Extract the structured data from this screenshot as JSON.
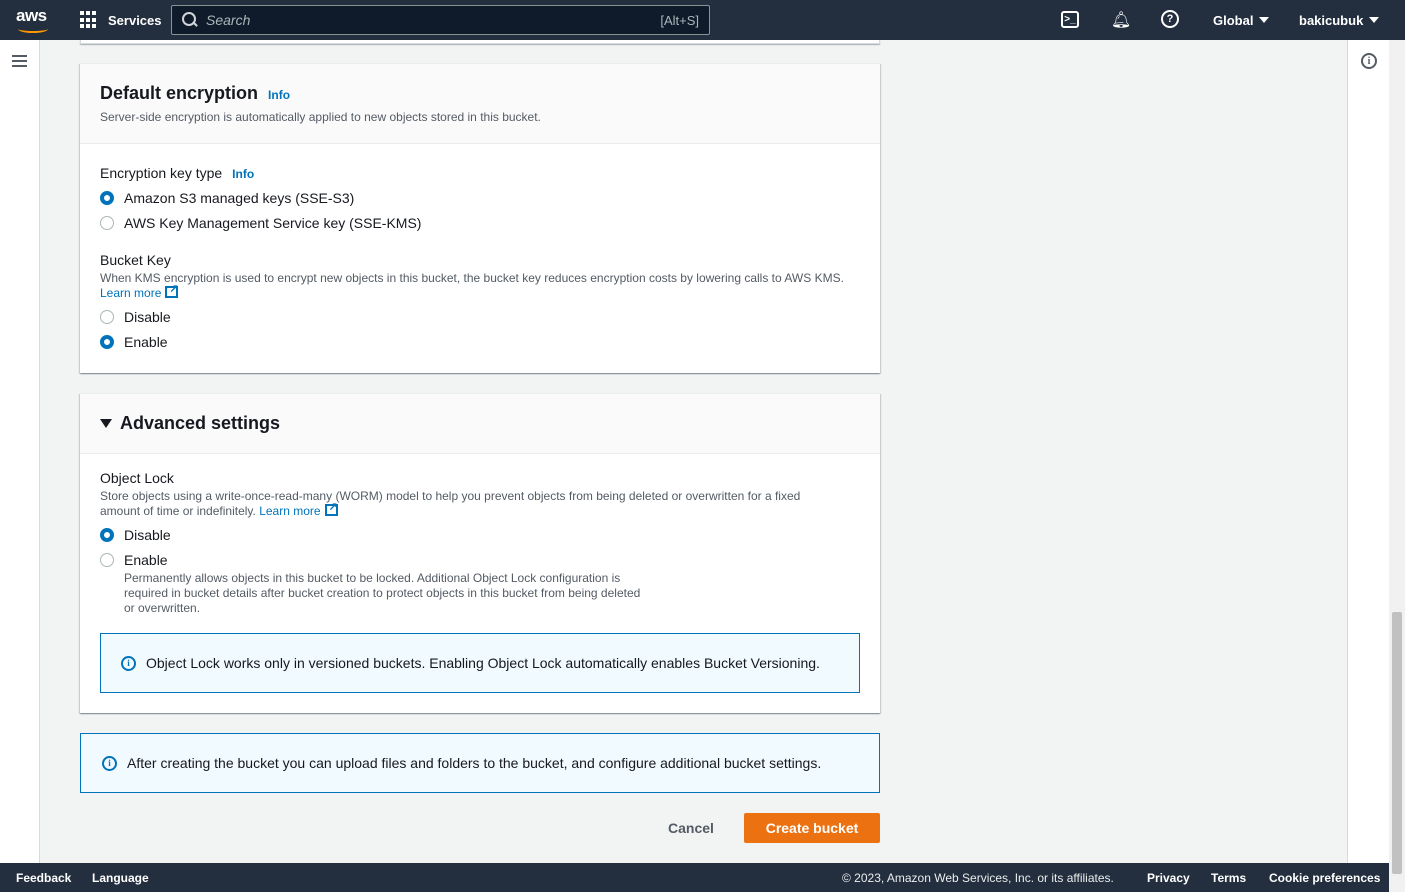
{
  "topnav": {
    "logo": "aws",
    "services_label": "Services",
    "search_placeholder": "Search",
    "search_shortcut": "[Alt+S]",
    "region_label": "Global",
    "user_label": "bakicubuk"
  },
  "default_encryption": {
    "title": "Default encryption",
    "info": "Info",
    "description": "Server-side encryption is automatically applied to new objects stored in this bucket.",
    "key_type_label": "Encryption key type",
    "key_type_info": "Info",
    "key_options": [
      "Amazon S3 managed keys (SSE-S3)",
      "AWS Key Management Service key (SSE-KMS)"
    ],
    "key_selected": 0,
    "bucket_key_label": "Bucket Key",
    "bucket_key_description": "When KMS encryption is used to encrypt new objects in this bucket, the bucket key reduces encryption costs by lowering calls to AWS KMS.",
    "bucket_key_learn_more": "Learn more",
    "bucket_key_options": [
      "Disable",
      "Enable"
    ],
    "bucket_key_selected": 1
  },
  "advanced_settings": {
    "title": "Advanced settings",
    "object_lock_label": "Object Lock",
    "object_lock_description": "Store objects using a write-once-read-many (WORM) model to help you prevent objects from being deleted or overwritten for a fixed amount of time or indefinitely.",
    "object_lock_learn_more": "Learn more",
    "object_lock_options": [
      "Disable",
      "Enable"
    ],
    "object_lock_selected": 0,
    "enable_description_1": "Permanently allows objects in this bucket to be locked. Additional Object Lock configuration is",
    "enable_description_2": "required in bucket details after bucket creation to protect objects in this bucket from being deleted",
    "enable_description_3": "or overwritten.",
    "alert_text": "Object Lock works only in versioned buckets. Enabling Object Lock automatically enables Bucket Versioning."
  },
  "bottom_alert": "After creating the bucket you can upload files and folders to the bucket, and configure additional bucket settings.",
  "actions": {
    "cancel": "Cancel",
    "create": "Create bucket"
  },
  "footer": {
    "feedback": "Feedback",
    "language": "Language",
    "copyright": "© 2023, Amazon Web Services, Inc. or its affiliates.",
    "privacy": "Privacy",
    "terms": "Terms",
    "cookies": "Cookie preferences"
  },
  "colors": {
    "nav_bg": "#232f3e",
    "link": "#0073bb",
    "primary_button": "#ec7211"
  }
}
